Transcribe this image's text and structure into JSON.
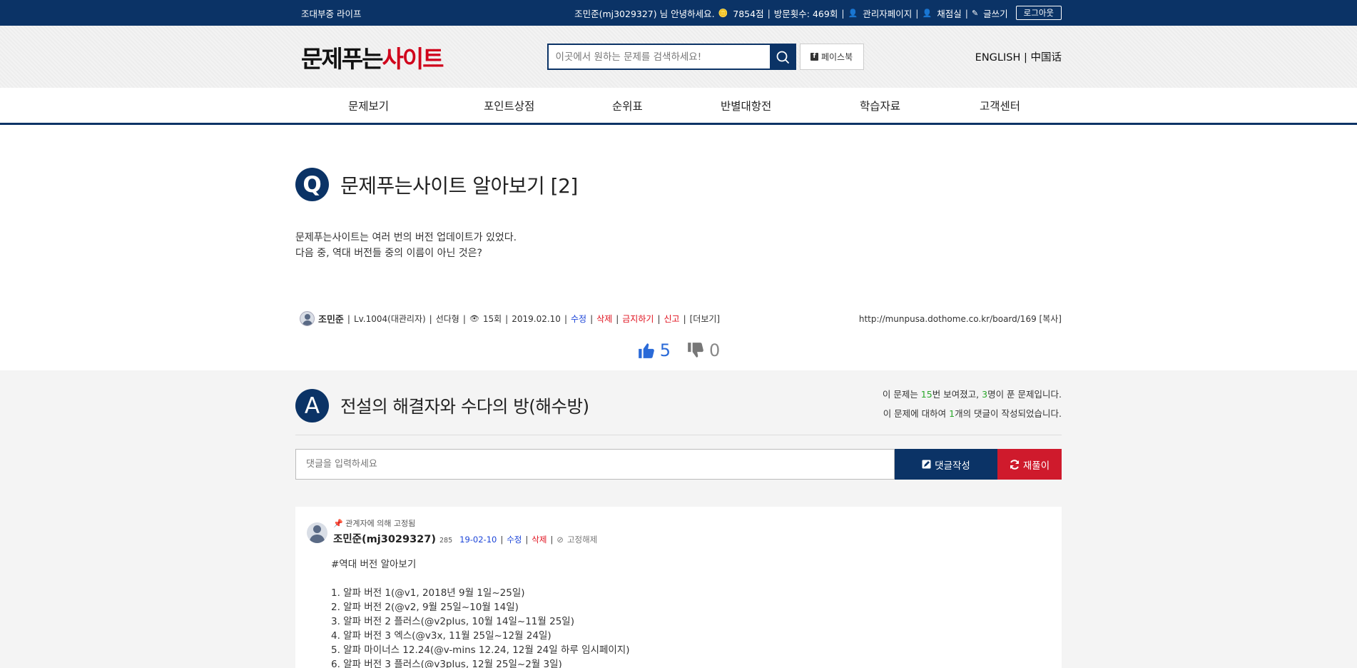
{
  "topbar": {
    "site_name": "조대부중 라이프",
    "greeting": "조민준(mj3029327) 님 안녕하세요.",
    "points": "7854점",
    "visits": "방문횟수: 469회",
    "admin_label": "관리자페이지",
    "grading_label": "채점실",
    "write_label": "글쓰기",
    "logout_label": "로그아웃"
  },
  "header": {
    "logo_part1": "문제푸는",
    "logo_part2": "사이트",
    "search_placeholder": "이곳에서 원하는 문제를 검색하세요!",
    "facebook_label": "페이스북",
    "lang_english": "ENGLISH",
    "lang_chinese": "中国话"
  },
  "nav": {
    "items": [
      "문제보기",
      "포인트상점",
      "순위표",
      "반별대항전",
      "학습자료",
      "고객센터"
    ]
  },
  "question": {
    "badge": "Q",
    "title": "문제푸는사이트 알아보기 [2]",
    "body_line1": "문제푸는사이트는 여러 번의 버전 업데이트가 있었다.",
    "body_line2": "다음 중, 역대 버전들 중의 이름이 아닌 것은?",
    "author": "조민준",
    "level": "Lv.1004(대관리자)",
    "type": "선다형",
    "views": "15회",
    "date": "2019.02.10",
    "edit": "수정",
    "delete": "삭제",
    "block": "금지하기",
    "report": "신고",
    "more": "[더보기]",
    "url": "http://munpusa.dothome.co.kr/board/169",
    "copy": "[복사]",
    "likes": "5",
    "dislikes": "0"
  },
  "answer": {
    "badge": "A",
    "title": "전설의 해결자와 수다의 방(해수방)",
    "stats_line1_a": "이 문제는 ",
    "stats_views": "15",
    "stats_line1_b": "번 보여졌고, ",
    "stats_solved": "3",
    "stats_line1_c": "명이 푼 문제입니다.",
    "stats_line2_a": "이 문제에 대하여 ",
    "stats_comments": "1",
    "stats_line2_b": "개의 댓글이 작성되었습니다.",
    "comment_placeholder": "댓글을 입력하세요",
    "write_button": "댓글작성",
    "retry_button": "재풀이"
  },
  "comment": {
    "pinned": "관계자에 의해 고정됨",
    "author": "조민준(mj3029327)",
    "points": "285",
    "date": "19-02-10",
    "edit": "수정",
    "delete": "삭제",
    "unpin": "고정해제",
    "text": "#역대 버전 알아보기\n\n1. 알파 버전 1(@v1, 2018년 9월 1일~25일)\n2. 알파 버전 2(@v2, 9월 25일~10월 14일)\n3. 알파 버전 2 플러스(@v2plus, 10월 14일~11월 25일)\n4. 알파 버전 3 엑스(@v3x, 11월 25일~12월 24일)\n5. 알파 마이너스 12.24(@v-mins 12.24, 12월 24일 하루 임시페이지)\n6. 알파 버전 3 플러스(@v3plus, 12월 25일~2월 3일)"
  },
  "colors": {
    "brand_navy": "#0b3366",
    "accent_red": "#d0021b",
    "link_blue": "#1b44d8",
    "stat_green": "#2aa82a"
  }
}
